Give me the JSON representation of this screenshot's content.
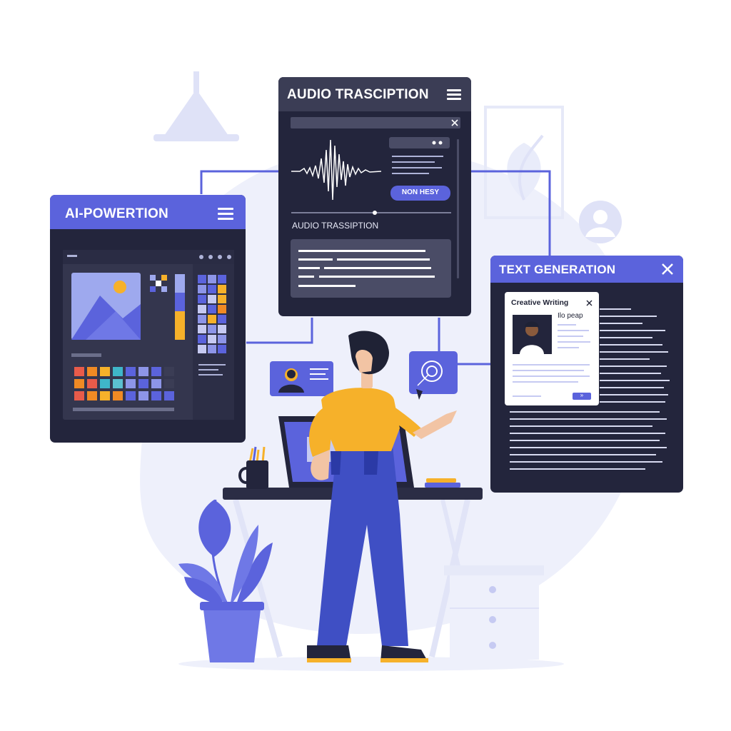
{
  "colors": {
    "accent": "#5b63dc",
    "panel_dark": "#23253c",
    "panel_mid": "#3b3d55",
    "shirt": "#f6b12a",
    "jeans": "#3f4fc4",
    "background_blob": "#eef0fb"
  },
  "panels": {
    "ai_power": {
      "title": "AI-POWERTION",
      "menu_icon": "hamburger-menu-icon"
    },
    "audio": {
      "title": "AUDIO TRASCIPTION",
      "menu_icon": "hamburger-menu-icon",
      "button_label": "NON HESY",
      "section_label": "AUDIO TRASSIPTION"
    },
    "text_generation": {
      "title": "TEXT GENERATION",
      "close_icon": "close-icon",
      "card": {
        "title": "Creative Writing",
        "name": "Ilo peap",
        "button_label": "»"
      }
    }
  }
}
